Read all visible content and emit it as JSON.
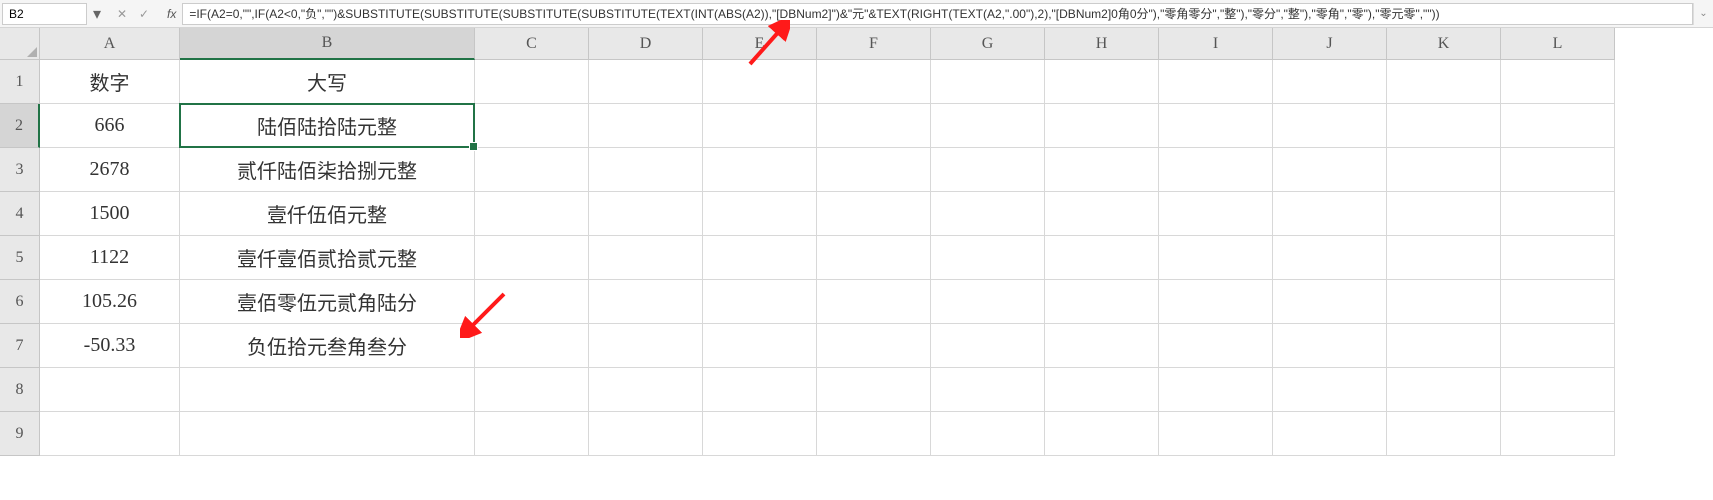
{
  "name_box": "B2",
  "fx_label": "fx",
  "formula": "=IF(A2=0,\"\",IF(A2<0,\"负\",\"\")&SUBSTITUTE(SUBSTITUTE(SUBSTITUTE(SUBSTITUTE(TEXT(INT(ABS(A2)),\"[DBNum2]\")&\"元\"&TEXT(RIGHT(TEXT(A2,\".00\"),2),\"[DBNum2]0角0分\"),\"零角零分\",\"整\"),\"零分\",\"整\"),\"零角\",\"零\"),\"零元零\",\"\"))",
  "columns": [
    "A",
    "B",
    "C",
    "D",
    "E",
    "F",
    "G",
    "H",
    "I",
    "J",
    "K",
    "L"
  ],
  "row_numbers": [
    "1",
    "2",
    "3",
    "4",
    "5",
    "6",
    "7",
    "8",
    "9"
  ],
  "selected_col_idx": 1,
  "selected_row_idx": 1,
  "chart_data": {
    "type": "table",
    "headers": [
      "数字",
      "大写"
    ],
    "rows": [
      [
        "666",
        "陆佰陆拾陆元整"
      ],
      [
        "2678",
        "贰仟陆佰柒拾捌元整"
      ],
      [
        "1500",
        "壹仟伍佰元整"
      ],
      [
        "1122",
        "壹仟壹佰贰拾贰元整"
      ],
      [
        "105.26",
        "壹佰零伍元贰角陆分"
      ],
      [
        "-50.33",
        "负伍拾元叁角叁分"
      ]
    ]
  }
}
